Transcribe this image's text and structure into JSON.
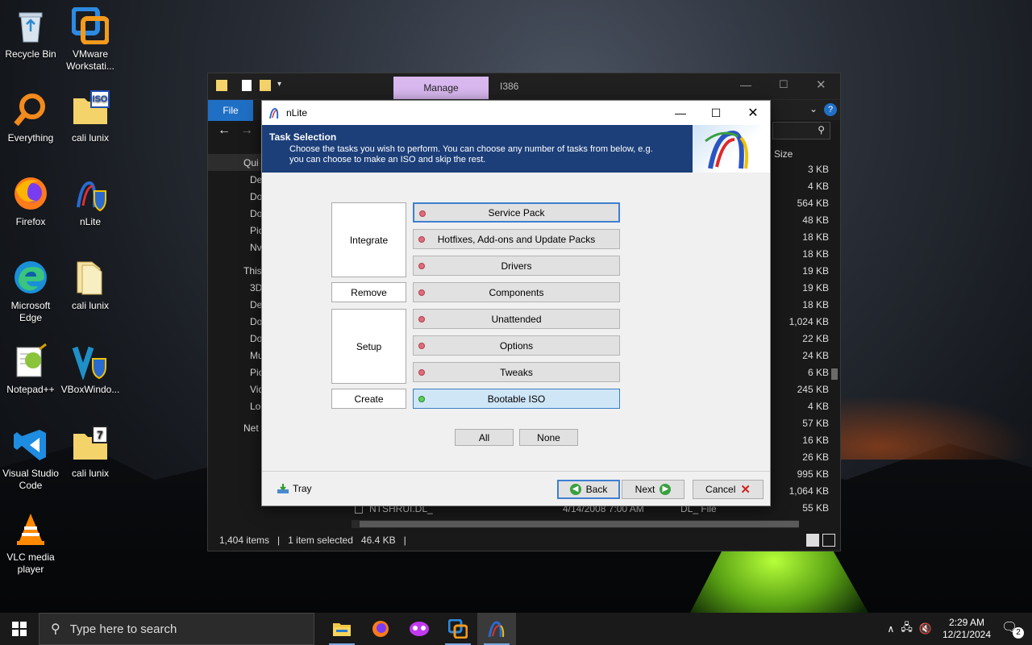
{
  "desktop": {
    "icons": [
      {
        "label": "Recycle Bin"
      },
      {
        "label": "VMware Workstati..."
      },
      {
        "label": "Everything"
      },
      {
        "label": "cali lunix"
      },
      {
        "label": "Firefox"
      },
      {
        "label": "nLite"
      },
      {
        "label": "Microsoft Edge"
      },
      {
        "label": "cali lunix"
      },
      {
        "label": "Notepad++"
      },
      {
        "label": "VBoxWindo..."
      },
      {
        "label": "Visual Studio Code"
      },
      {
        "label": "cali lunix"
      },
      {
        "label": "VLC media player"
      }
    ],
    "iso_badge": "ISO",
    "seven_badge": "7"
  },
  "explorer": {
    "manage_tab": "Manage",
    "title": "I386",
    "file_tab": "File",
    "nav_items": [
      "Qui",
      "De",
      "Do",
      "Do",
      "Pic",
      "Nv",
      "This",
      "3D",
      "De",
      "Do",
      "Do",
      "Mu",
      "Pic",
      "Vid",
      "Loc",
      "Net"
    ],
    "size_header": "Size",
    "sizes": [
      "3 KB",
      "4 KB",
      "564 KB",
      "48 KB",
      "18 KB",
      "18 KB",
      "19 KB",
      "19 KB",
      "18 KB",
      "1,024 KB",
      "22 KB",
      "24 KB",
      "6 KB",
      "245 KB",
      "4 KB",
      "57 KB",
      "16 KB",
      "26 KB",
      "995 KB",
      "1,064 KB",
      "55 KB"
    ],
    "partial_row": {
      "name": "NTSHRUI.DL_",
      "date": "4/14/2008 7:00 AM",
      "type": "DL_ File"
    },
    "status": {
      "items": "1,404 items",
      "selected": "1 item selected",
      "size": "46.4 KB"
    }
  },
  "nlite": {
    "title": "nLite",
    "header_title": "Task Selection",
    "header_line1": "Choose the tasks you wish to perform. You can choose any number of tasks from below, e.g.",
    "header_line2": "you can choose to make an ISO and skip the rest.",
    "categories": {
      "integrate": "Integrate",
      "remove": "Remove",
      "setup": "Setup",
      "create": "Create"
    },
    "tasks": [
      "Service Pack",
      "Hotfixes, Add-ons and Update Packs",
      "Drivers",
      "Components",
      "Unattended",
      "Options",
      "Tweaks",
      "Bootable ISO"
    ],
    "all_button": "All",
    "none_button": "None",
    "tray": "Tray",
    "back": "Back",
    "next": "Next",
    "cancel": "Cancel"
  },
  "taskbar": {
    "search_placeholder": "Type here to search",
    "time": "2:29 AM",
    "date": "12/21/2024",
    "notification_count": "2"
  }
}
